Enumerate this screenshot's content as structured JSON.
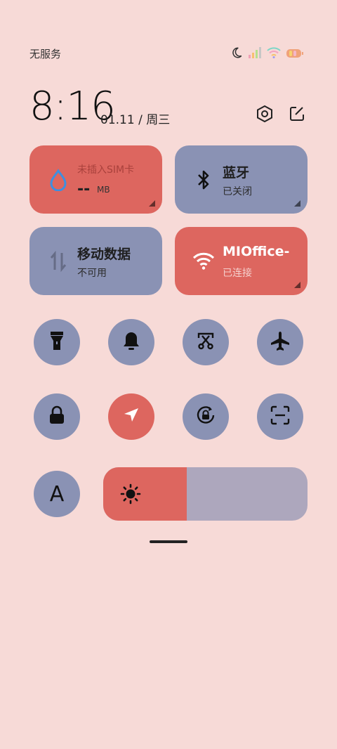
{
  "status": {
    "carrier": "无服务",
    "icons": [
      "moon-icon",
      "signal-icon",
      "wifi-icon",
      "battery-icon"
    ]
  },
  "header": {
    "time": "8:16",
    "date": "01.11 / 周三",
    "settings_icon": "settings-hex-icon",
    "edit_icon": "edit-icon"
  },
  "tiles": {
    "data_usage": {
      "title": "未插入SIM卡",
      "value": "--",
      "unit": "MB",
      "icon": "water-drop-icon"
    },
    "bluetooth": {
      "title": "蓝牙",
      "subtitle": "已关闭",
      "icon": "bluetooth-icon"
    },
    "mobile_data": {
      "title": "移动数据",
      "subtitle": "不可用",
      "icon": "data-arrows-icon"
    },
    "wifi": {
      "title": "MIOffice-",
      "subtitle": "已连接",
      "icon": "wifi-icon"
    }
  },
  "toggles_row1": [
    {
      "name": "flashlight",
      "icon": "flashlight-icon",
      "active": false
    },
    {
      "name": "ringer",
      "icon": "bell-icon",
      "active": false
    },
    {
      "name": "screenshot",
      "icon": "scissors-screenshot-icon",
      "active": false
    },
    {
      "name": "airplane",
      "icon": "airplane-icon",
      "active": false
    }
  ],
  "toggles_row2": [
    {
      "name": "lock",
      "icon": "lock-icon",
      "active": false
    },
    {
      "name": "location",
      "icon": "location-arrow-icon",
      "active": true
    },
    {
      "name": "rotation-lock",
      "icon": "rotation-lock-icon",
      "active": false
    },
    {
      "name": "scanner",
      "icon": "scan-icon",
      "active": false
    }
  ],
  "font_toggle": {
    "label": "A"
  },
  "brightness": {
    "level": 0.41,
    "icon": "sun-icon"
  },
  "colors": {
    "background": "#f7dad7",
    "active": "#dd665f",
    "inactive": "#8a92b4",
    "slider_track": "#ada7bd"
  }
}
